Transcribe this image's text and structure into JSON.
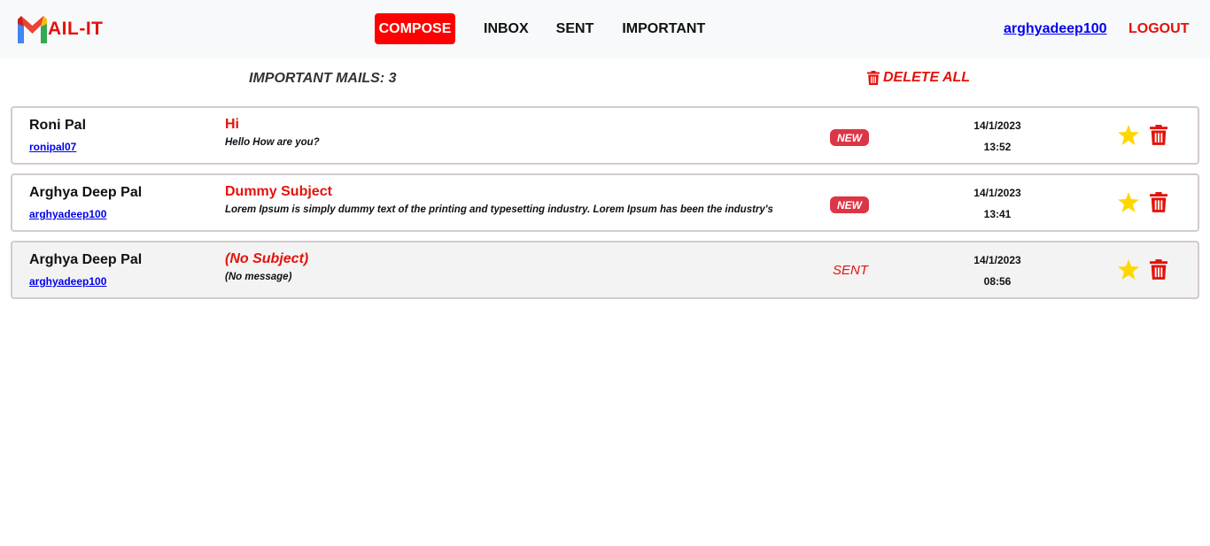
{
  "header": {
    "brand_suffix": "AIL-IT",
    "nav": {
      "compose": "COMPOSE",
      "inbox": "INBOX",
      "sent": "SENT",
      "important": "IMPORTANT"
    },
    "username": "arghyadeep100",
    "logout": "LOGOUT"
  },
  "toolbar": {
    "count_label": "IMPORTANT MAILS: 3",
    "delete_all": "DELETE ALL"
  },
  "mails": [
    {
      "sender_name": "Roni Pal",
      "sender_id": "ronipal07",
      "subject": "Hi",
      "preview": "Hello How are you?",
      "status": "NEW",
      "date": "14/1/2023",
      "time": "13:52"
    },
    {
      "sender_name": "Arghya Deep Pal",
      "sender_id": "arghyadeep100",
      "subject": "Dummy Subject",
      "preview": "Lorem Ipsum is simply dummy text of the printing and typesetting industry. Lorem Ipsum has been the industry's",
      "status": "NEW",
      "date": "14/1/2023",
      "time": "13:41"
    },
    {
      "sender_name": "Arghya Deep Pal",
      "sender_id": "arghyadeep100",
      "subject": "(No Subject)",
      "preview": "(No message)",
      "status": "SENT",
      "date": "14/1/2023",
      "time": "08:56"
    }
  ],
  "colors": {
    "accent_red": "#e3120b",
    "compose_bg": "#ff0000",
    "badge_new": "#dc3545",
    "star": "#ffd700",
    "link_blue": "#0000ee"
  },
  "icons": [
    "gmail-logo-icon",
    "trash-icon",
    "star-icon"
  ]
}
